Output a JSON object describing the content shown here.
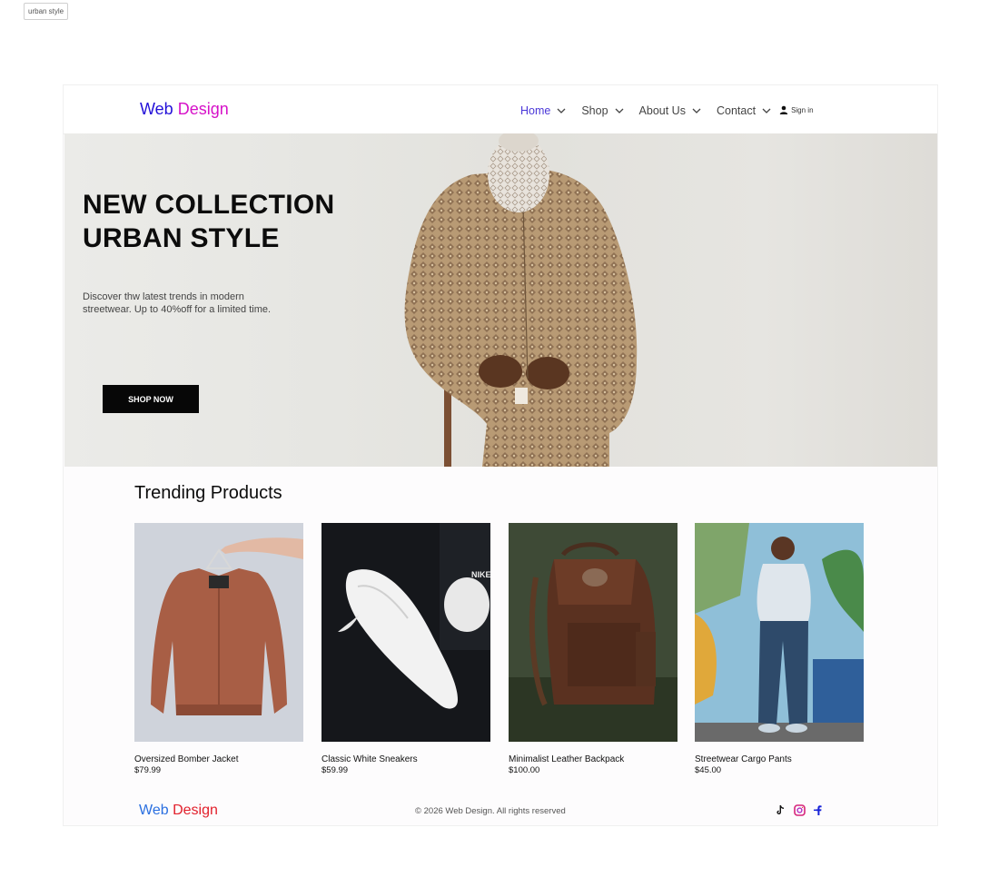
{
  "tag_label": "urban style",
  "nav": {
    "brand_part1": "Web",
    "brand_part2": "Design",
    "items": [
      {
        "label": "Home"
      },
      {
        "label": "Shop"
      },
      {
        "label": "About Us"
      },
      {
        "label": "Contact"
      }
    ],
    "signin_label": "Sign in"
  },
  "hero": {
    "title_line1": "NEW COLLECTION",
    "title_line2": "URBAN STYLE",
    "description": "Discover thw latest trends in modern streetwear. Up to 40%off for a limited time.",
    "button_label": "SHOP NOW"
  },
  "trending": {
    "title": "Trending Products",
    "products": [
      {
        "name": "Oversized Bomber Jacket",
        "price": "$79.99"
      },
      {
        "name": "Classic White Sneakers",
        "price": "$59.99"
      },
      {
        "name": "Minimalist Leather Backpack",
        "price": "$100.00"
      },
      {
        "name": "Streetwear Cargo Pants",
        "price": "$45.00"
      }
    ]
  },
  "footer": {
    "brand_part1": "Web",
    "brand_part2": "Design",
    "copyright": "© 2026 Web Design. All rights reserved",
    "socials": [
      "tiktok-icon",
      "instagram-icon",
      "facebook-icon"
    ]
  },
  "colors": {
    "nav_brand_1": "#2310d8",
    "nav_brand_2": "#d612c8",
    "nav_active": "#4a37d8",
    "button_bg": "#070707",
    "footer_brand_1": "#2a6fe0",
    "footer_brand_2": "#e2202c"
  }
}
